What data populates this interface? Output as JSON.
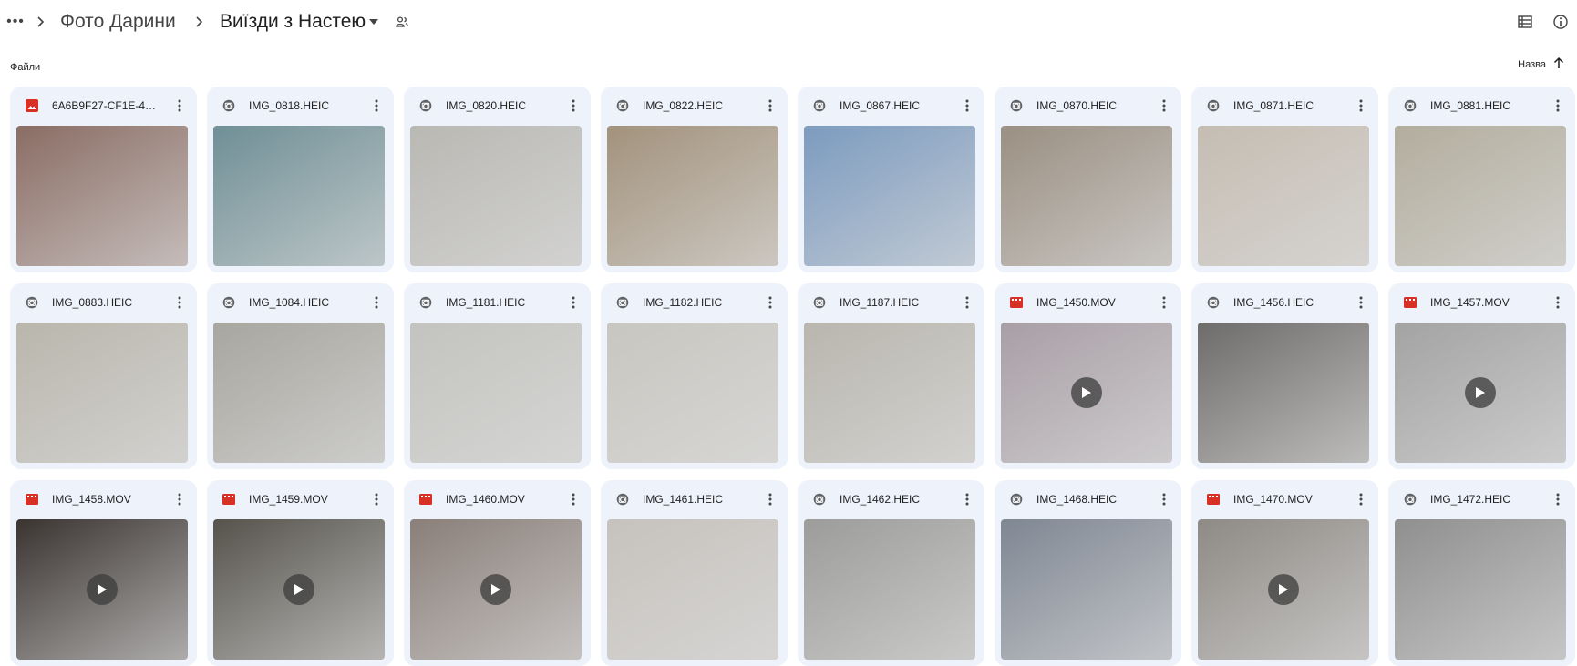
{
  "breadcrumb": {
    "items": [
      "Фото Дарини",
      "Виїзди з Настею"
    ]
  },
  "section": {
    "label": "Файли"
  },
  "sort": {
    "label": "Назва"
  },
  "icons": {
    "more": "more-horiz-icon",
    "separator": "chevron-right-icon",
    "dropdown": "caret-down-icon",
    "shared": "shared-people-icon",
    "list_view": "list-view-icon",
    "info": "info-icon",
    "sort_arrow": "arrow-up-icon",
    "image_type": "image-file-icon",
    "photo_type": "photo-file-icon",
    "video_type": "video-file-icon",
    "kebab": "more-vert-icon",
    "play": "play-icon"
  },
  "colors": {
    "card_bg": "#eef2fa",
    "image_type": "#d93025",
    "video_type": "#d93025",
    "photo_type": "#5f6368"
  },
  "files": [
    {
      "name": "6A6B9F27-CF1E-4A...",
      "type": "image",
      "thumb": "#8a6d64"
    },
    {
      "name": "IMG_0818.HEIC",
      "type": "photo",
      "thumb": "#6f8f96"
    },
    {
      "name": "IMG_0820.HEIC",
      "type": "photo",
      "thumb": "#b9b8b3"
    },
    {
      "name": "IMG_0822.HEIC",
      "type": "photo",
      "thumb": "#a2927c"
    },
    {
      "name": "IMG_0867.HEIC",
      "type": "photo",
      "thumb": "#7c9bbf"
    },
    {
      "name": "IMG_0870.HEIC",
      "type": "photo",
      "thumb": "#9a8f82"
    },
    {
      "name": "IMG_0871.HEIC",
      "type": "photo",
      "thumb": "#c5bdb2"
    },
    {
      "name": "IMG_0881.HEIC",
      "type": "photo",
      "thumb": "#b2ad9d"
    },
    {
      "name": "IMG_0883.HEIC",
      "type": "photo",
      "thumb": "#b9b6ac"
    },
    {
      "name": "IMG_1084.HEIC",
      "type": "photo",
      "thumb": "#a7a69f"
    },
    {
      "name": "IMG_1181.HEIC",
      "type": "photo",
      "thumb": "#c3c3bf"
    },
    {
      "name": "IMG_1182.HEIC",
      "type": "photo",
      "thumb": "#c8c6c0"
    },
    {
      "name": "IMG_1187.HEIC",
      "type": "photo",
      "thumb": "#b9b6ae"
    },
    {
      "name": "IMG_1450.MOV",
      "type": "video",
      "thumb": "#a89fa6"
    },
    {
      "name": "IMG_1456.HEIC",
      "type": "photo",
      "thumb": "#6e6c6a"
    },
    {
      "name": "IMG_1457.MOV",
      "type": "video",
      "thumb": "#a3a3a3"
    },
    {
      "name": "IMG_1458.MOV",
      "type": "video",
      "thumb": "#3a3431"
    },
    {
      "name": "IMG_1459.MOV",
      "type": "video",
      "thumb": "#56534c"
    },
    {
      "name": "IMG_1460.MOV",
      "type": "video",
      "thumb": "#8a7f79"
    },
    {
      "name": "IMG_1461.HEIC",
      "type": "photo",
      "thumb": "#c6c2bd"
    },
    {
      "name": "IMG_1462.HEIC",
      "type": "photo",
      "thumb": "#9c9c9a"
    },
    {
      "name": "IMG_1468.HEIC",
      "type": "photo",
      "thumb": "#7f8793"
    },
    {
      "name": "IMG_1470.MOV",
      "type": "video",
      "thumb": "#8e8a85"
    },
    {
      "name": "IMG_1472.HEIC",
      "type": "photo",
      "thumb": "#8f8f8f"
    }
  ]
}
